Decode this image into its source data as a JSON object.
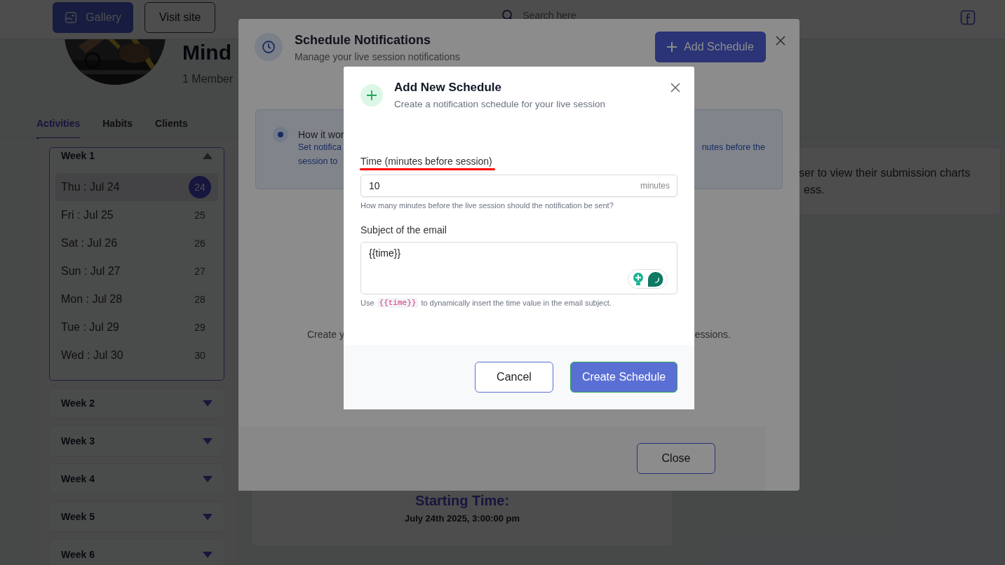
{
  "header": {
    "buttons": [
      {
        "label": "Gallery",
        "kind": "primary"
      },
      {
        "label": "Visit site",
        "kind": "outline"
      }
    ],
    "search": {
      "placeholder": "Search here"
    }
  },
  "profile": {
    "name": "Mind",
    "members": "1 Member"
  },
  "tabs": [
    {
      "label": "Activities",
      "selected": true
    },
    {
      "label": "Habits",
      "selected": false
    },
    {
      "label": "Clients",
      "selected": false
    }
  ],
  "weeks": [
    {
      "label": "Week 1",
      "expanded": true,
      "days": [
        {
          "label": "Thu : Jul 24",
          "date": "24",
          "selected": true
        },
        {
          "label": "Fri : Jul 25",
          "date": "25",
          "selected": false
        },
        {
          "label": "Sat : Jul 26",
          "date": "26",
          "selected": false
        },
        {
          "label": "Sun : Jul 27",
          "date": "27",
          "selected": false
        },
        {
          "label": "Mon : Jul 28",
          "date": "28",
          "selected": false
        },
        {
          "label": "Tue : Jul 29",
          "date": "29",
          "selected": false
        },
        {
          "label": "Wed : Jul 30",
          "date": "30",
          "selected": false
        }
      ]
    },
    {
      "label": "Week 2",
      "expanded": false
    },
    {
      "label": "Week 3",
      "expanded": false
    },
    {
      "label": "Week 4",
      "expanded": false
    },
    {
      "label": "Week 5",
      "expanded": false
    },
    {
      "label": "Week 6",
      "expanded": false
    }
  ],
  "info_card": {
    "lines": [
      "ser to view their submission charts",
      "ess."
    ]
  },
  "session_card": {
    "heading": "Starting Time:",
    "time": "July 24th 2025, 3:00:00 pm"
  },
  "schedule_dialog": {
    "title": "Schedule Notifications",
    "subtitle": "Manage your live session notifications",
    "add_button": "Add Schedule",
    "info": {
      "title": "How it wor",
      "line_1_start": "Set notifica",
      "line_1_end": "nutes before the",
      "line_2_start": "session to"
    },
    "empty_start": "Create y",
    "empty_end": "essions.",
    "close_button": "Close"
  },
  "add_dialog": {
    "title": "Add New Schedule",
    "subtitle": "Create a notification schedule for your live session",
    "time_field": {
      "label": "Time (minutes before session)",
      "highlighted": true,
      "value": "10",
      "suffix": "minutes",
      "help": "How many minutes before the live session should the notification be sent?"
    },
    "subject_field": {
      "label": "Subject of the email",
      "value": "{{time}}",
      "help_start": "Use",
      "help_code": "{{time}}",
      "help_end": "to dynamically insert the time value in the email subject."
    },
    "buttons": [
      {
        "label": "Cancel",
        "kind": "secondary"
      },
      {
        "label": "Create Schedule",
        "kind": "primary"
      }
    ]
  }
}
